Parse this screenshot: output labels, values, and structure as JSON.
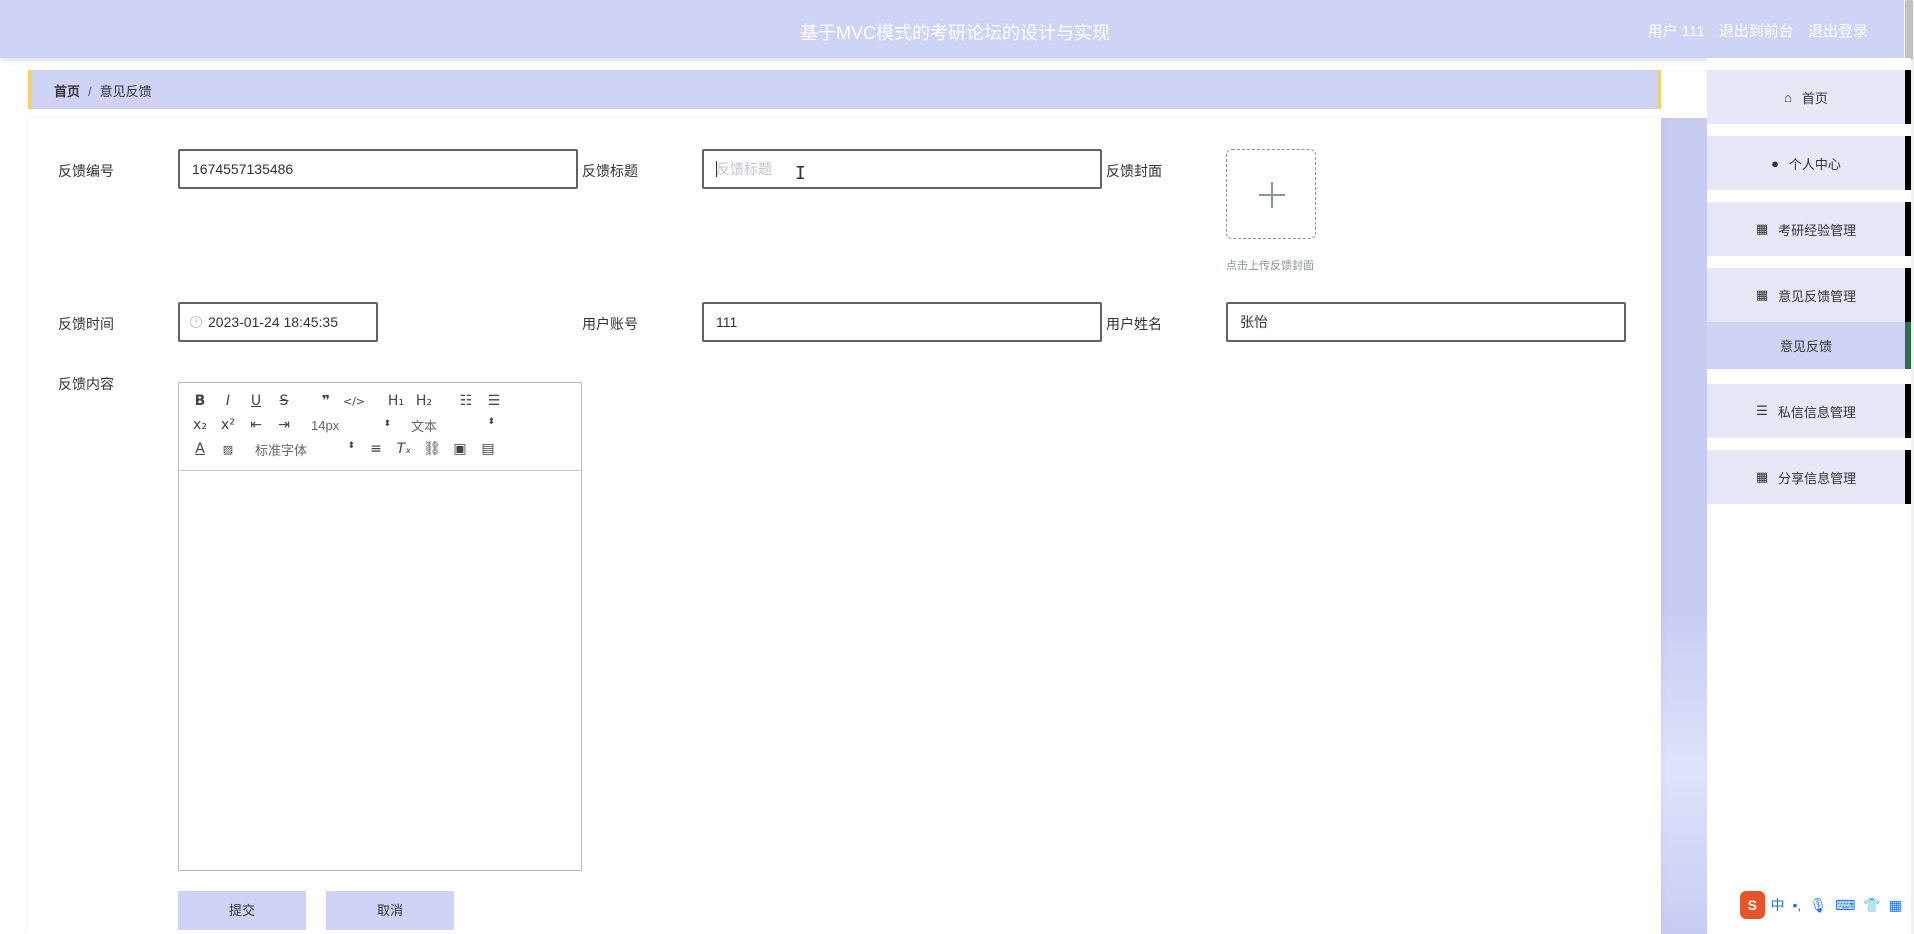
{
  "header": {
    "title": "基于MVC模式的考研论坛的设计与实现",
    "user_text": "用户 111",
    "back_to_front": "退出到前台",
    "logout": "退出登录"
  },
  "breadcrumb": {
    "home": "首页",
    "separator": "/",
    "current": "意见反馈"
  },
  "form": {
    "id_label": "反馈编号",
    "id_value": "1674557135486",
    "title_label": "反馈标题",
    "title_placeholder": "反馈标题",
    "cover_label": "反馈封面",
    "cover_tip": "点击上传反馈封面",
    "time_label": "反馈时间",
    "time_value": "2023-01-24 18:45:35",
    "account_label": "用户账号",
    "account_value": "111",
    "name_label": "用户姓名",
    "name_value": "张怡",
    "content_label": "反馈内容"
  },
  "editor": {
    "font_size": "14px",
    "header_type": "文本",
    "font_family": "标准字体"
  },
  "buttons": {
    "submit": "提交",
    "cancel": "取消"
  },
  "sidebar": {
    "items": [
      {
        "label": "首页",
        "icon": "home-icon"
      },
      {
        "label": "个人中心",
        "icon": "user-icon"
      },
      {
        "label": "考研经验管理",
        "icon": "grid-icon"
      },
      {
        "label": "意见反馈管理",
        "icon": "grid-icon"
      },
      {
        "label": "私信信息管理",
        "icon": "list-icon"
      },
      {
        "label": "分享信息管理",
        "icon": "grid-icon"
      }
    ],
    "sub_item": "意见反馈"
  },
  "ime": {
    "logo": "S",
    "mode": "中"
  },
  "colors": {
    "header_bg": "#cfd3f5",
    "accent_border": "#f5d26b",
    "menu_bg": "#e6e8f8"
  }
}
